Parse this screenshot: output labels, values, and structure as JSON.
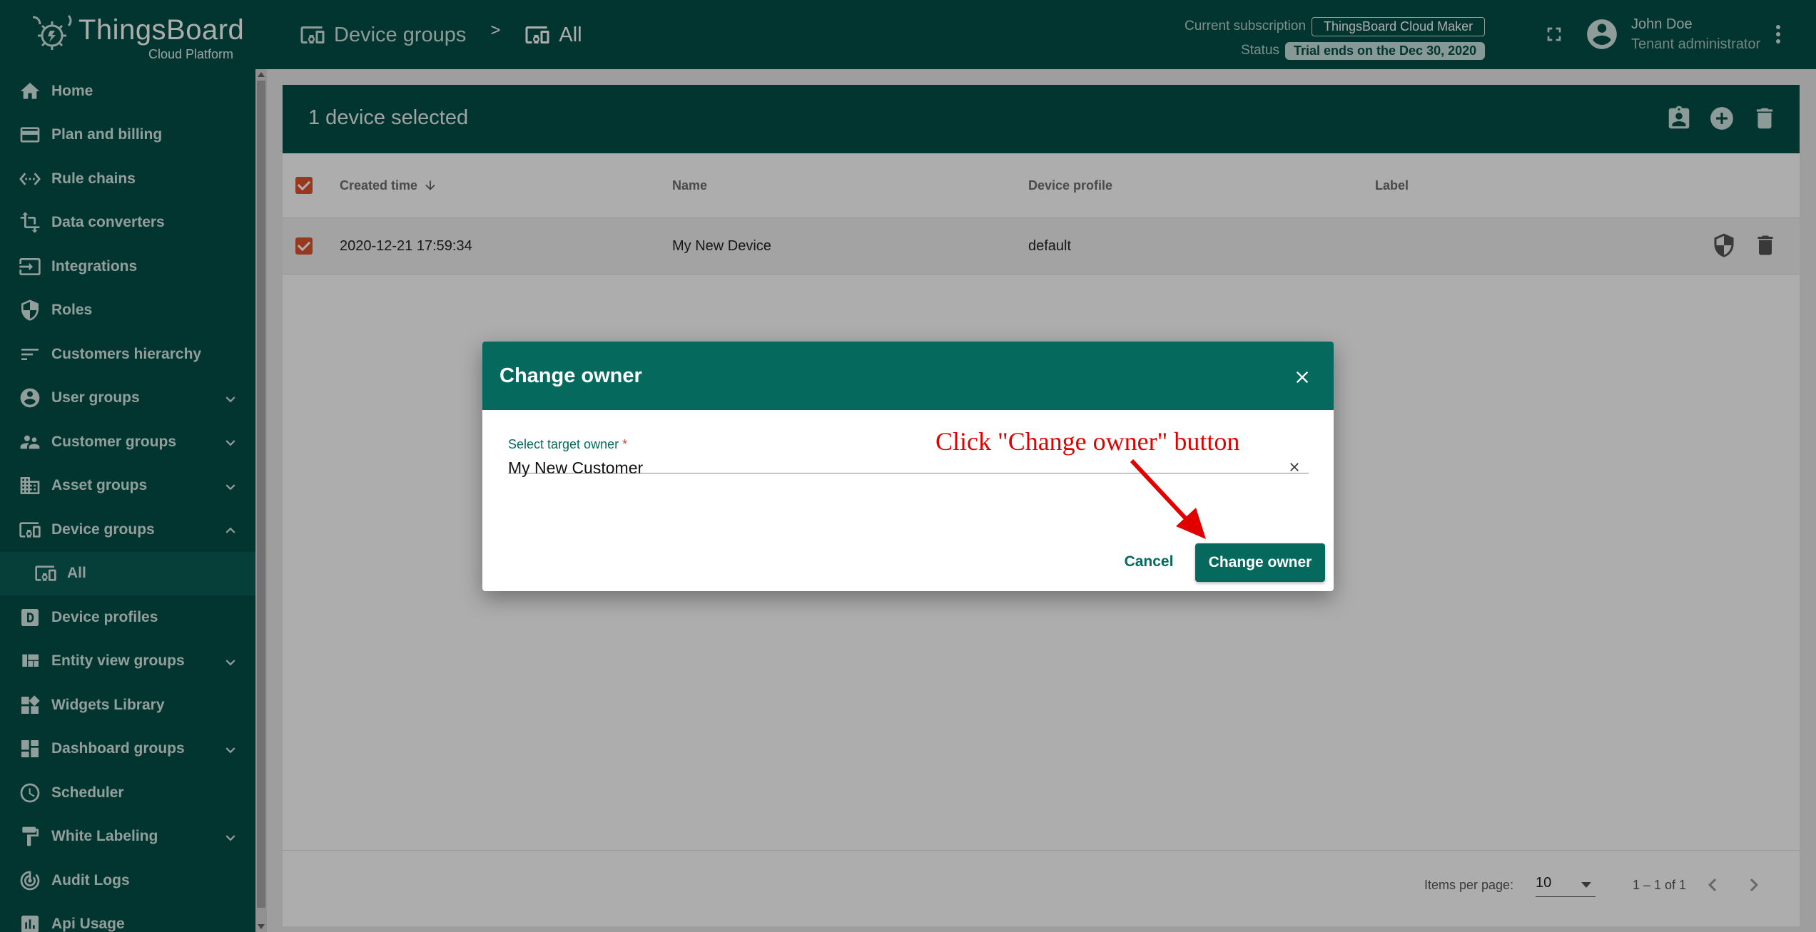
{
  "app": {
    "brand": "ThingsBoard",
    "brand_sub": "Cloud Platform"
  },
  "breadcrumb": [
    {
      "label": "Device groups",
      "icon": "devices-icon"
    },
    {
      "label": "All",
      "icon": "devices-icon"
    }
  ],
  "breadcrumb_separator": ">",
  "subscription": {
    "label": "Current subscription",
    "plan": "ThingsBoard Cloud Maker",
    "status_label": "Status",
    "status": "Trial ends on the Dec 30, 2020"
  },
  "user": {
    "name": "John Doe",
    "role": "Tenant administrator"
  },
  "sidebar": {
    "items": [
      {
        "label": "Home",
        "icon": "home-icon"
      },
      {
        "label": "Plan and billing",
        "icon": "credit-card-icon"
      },
      {
        "label": "Rule chains",
        "icon": "settings-ethernet-icon"
      },
      {
        "label": "Data converters",
        "icon": "transform-icon"
      },
      {
        "label": "Integrations",
        "icon": "input-icon"
      },
      {
        "label": "Roles",
        "icon": "security-icon"
      },
      {
        "label": "Customers hierarchy",
        "icon": "sort-icon"
      },
      {
        "label": "User groups",
        "icon": "account-circle-icon",
        "expand": "down"
      },
      {
        "label": "Customer groups",
        "icon": "supervisor-account-icon",
        "expand": "down"
      },
      {
        "label": "Asset groups",
        "icon": "domain-icon",
        "expand": "down"
      },
      {
        "label": "Device groups",
        "icon": "devices-other-icon",
        "expand": "up"
      },
      {
        "label": "All",
        "icon": "devices-other-icon",
        "sub": true
      },
      {
        "label": "Device profiles",
        "icon": "device-profile-icon"
      },
      {
        "label": "Entity view groups",
        "icon": "view-quilt-icon",
        "expand": "down"
      },
      {
        "label": "Widgets Library",
        "icon": "widgets-icon"
      },
      {
        "label": "Dashboard groups",
        "icon": "dashboard-icon",
        "expand": "down"
      },
      {
        "label": "Scheduler",
        "icon": "schedule-icon"
      },
      {
        "label": "White Labeling",
        "icon": "format-paint-icon",
        "expand": "down"
      },
      {
        "label": "Audit Logs",
        "icon": "track-changes-icon"
      },
      {
        "label": "Api Usage",
        "icon": "insert-chart-icon"
      }
    ]
  },
  "table": {
    "selection_title": "1 device selected",
    "columns": [
      "Created time",
      "Name",
      "Device profile",
      "Label"
    ],
    "sort_indicator": "arrow-downward-icon",
    "rows": [
      {
        "created": "2020-12-21 17:59:34",
        "name": "My New Device",
        "profile": "default",
        "label": ""
      }
    ],
    "paginator": {
      "items_per_page_label": "Items per page:",
      "items_per_page": "10",
      "range": "1 – 1 of 1"
    }
  },
  "dialog": {
    "title": "Change owner",
    "field_label": "Select target owner",
    "required_mark": "*",
    "field_value": "My New Customer",
    "cancel_label": "Cancel",
    "submit_label": "Change owner"
  },
  "annotation": {
    "text": "Click \"Change owner\" button",
    "color": "#e00000"
  },
  "colors": {
    "primary": "#054f47",
    "dialog_header": "#05695d",
    "checkbox": "#e0552e"
  }
}
